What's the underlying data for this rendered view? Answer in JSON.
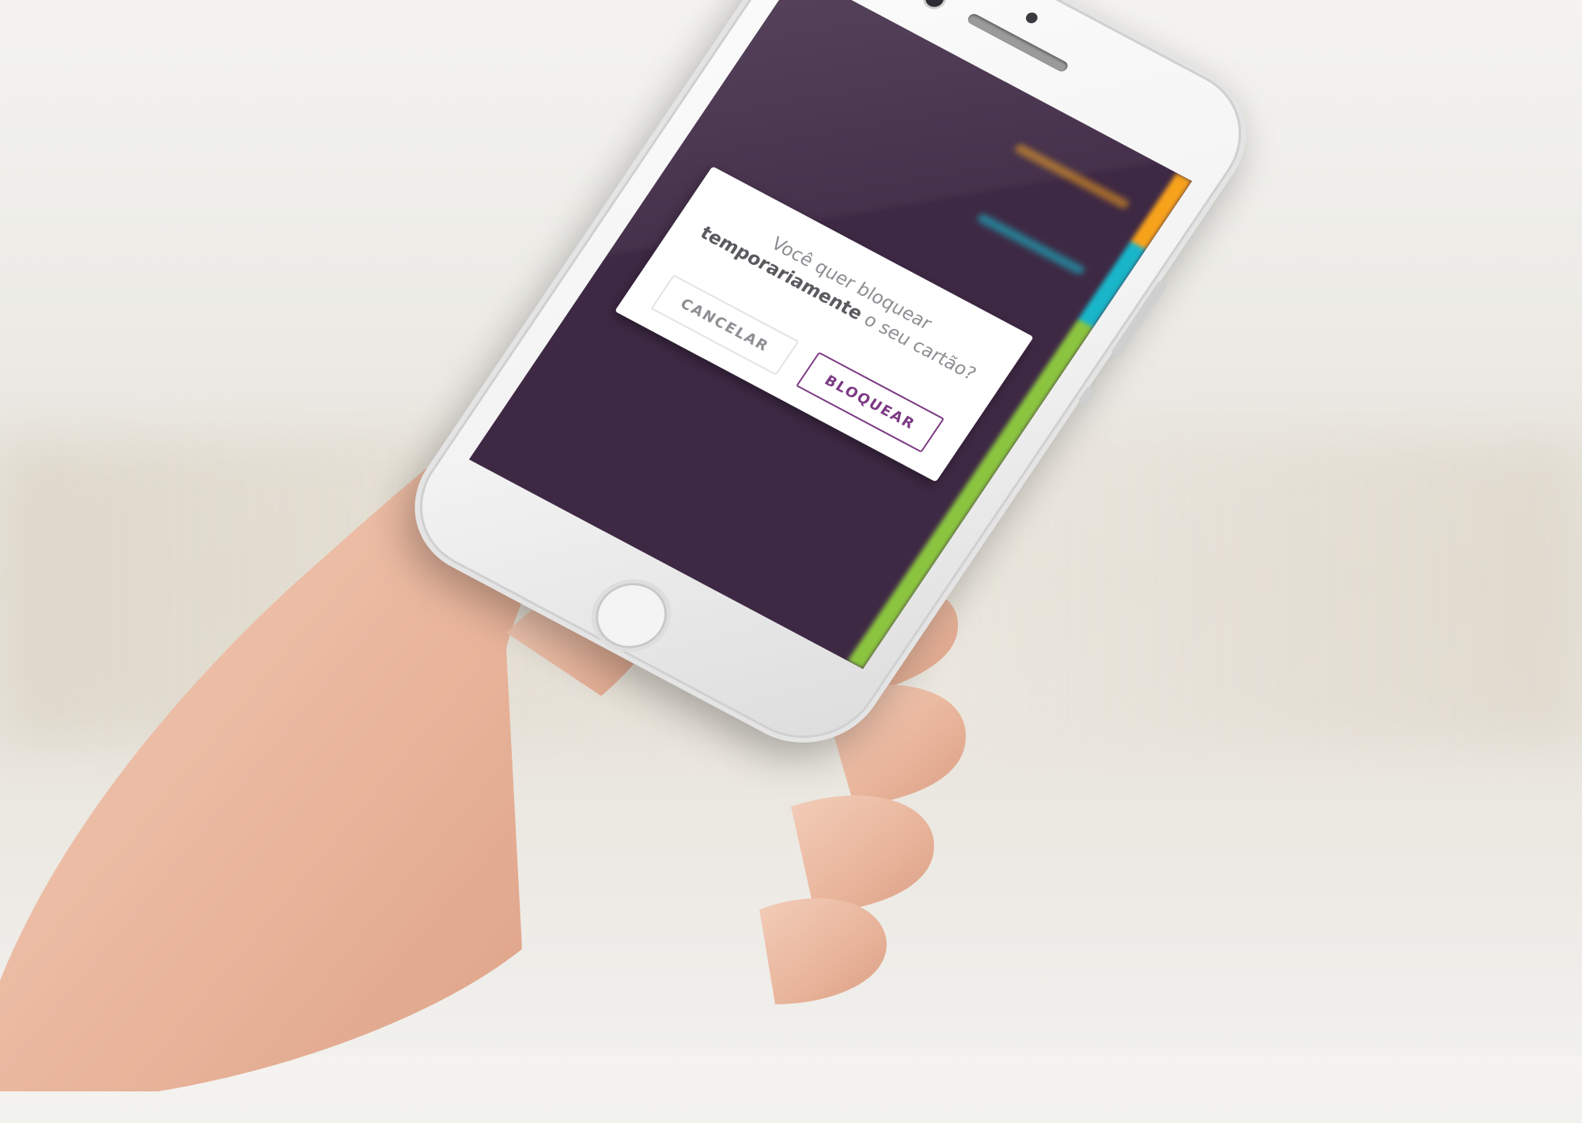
{
  "dialog": {
    "message_prefix": "Você quer bloquear",
    "message_bold": "temporariamente",
    "message_suffix": " o seu cartão?",
    "cancel_label": "CANCELAR",
    "confirm_label": "BLOQUEAR"
  },
  "colors": {
    "screen_bg": "#3e2944",
    "accent_orange": "#f7a21b",
    "accent_teal": "#19b6c9",
    "accent_green": "#8bc53f",
    "brand_purple": "#7b3a83"
  }
}
